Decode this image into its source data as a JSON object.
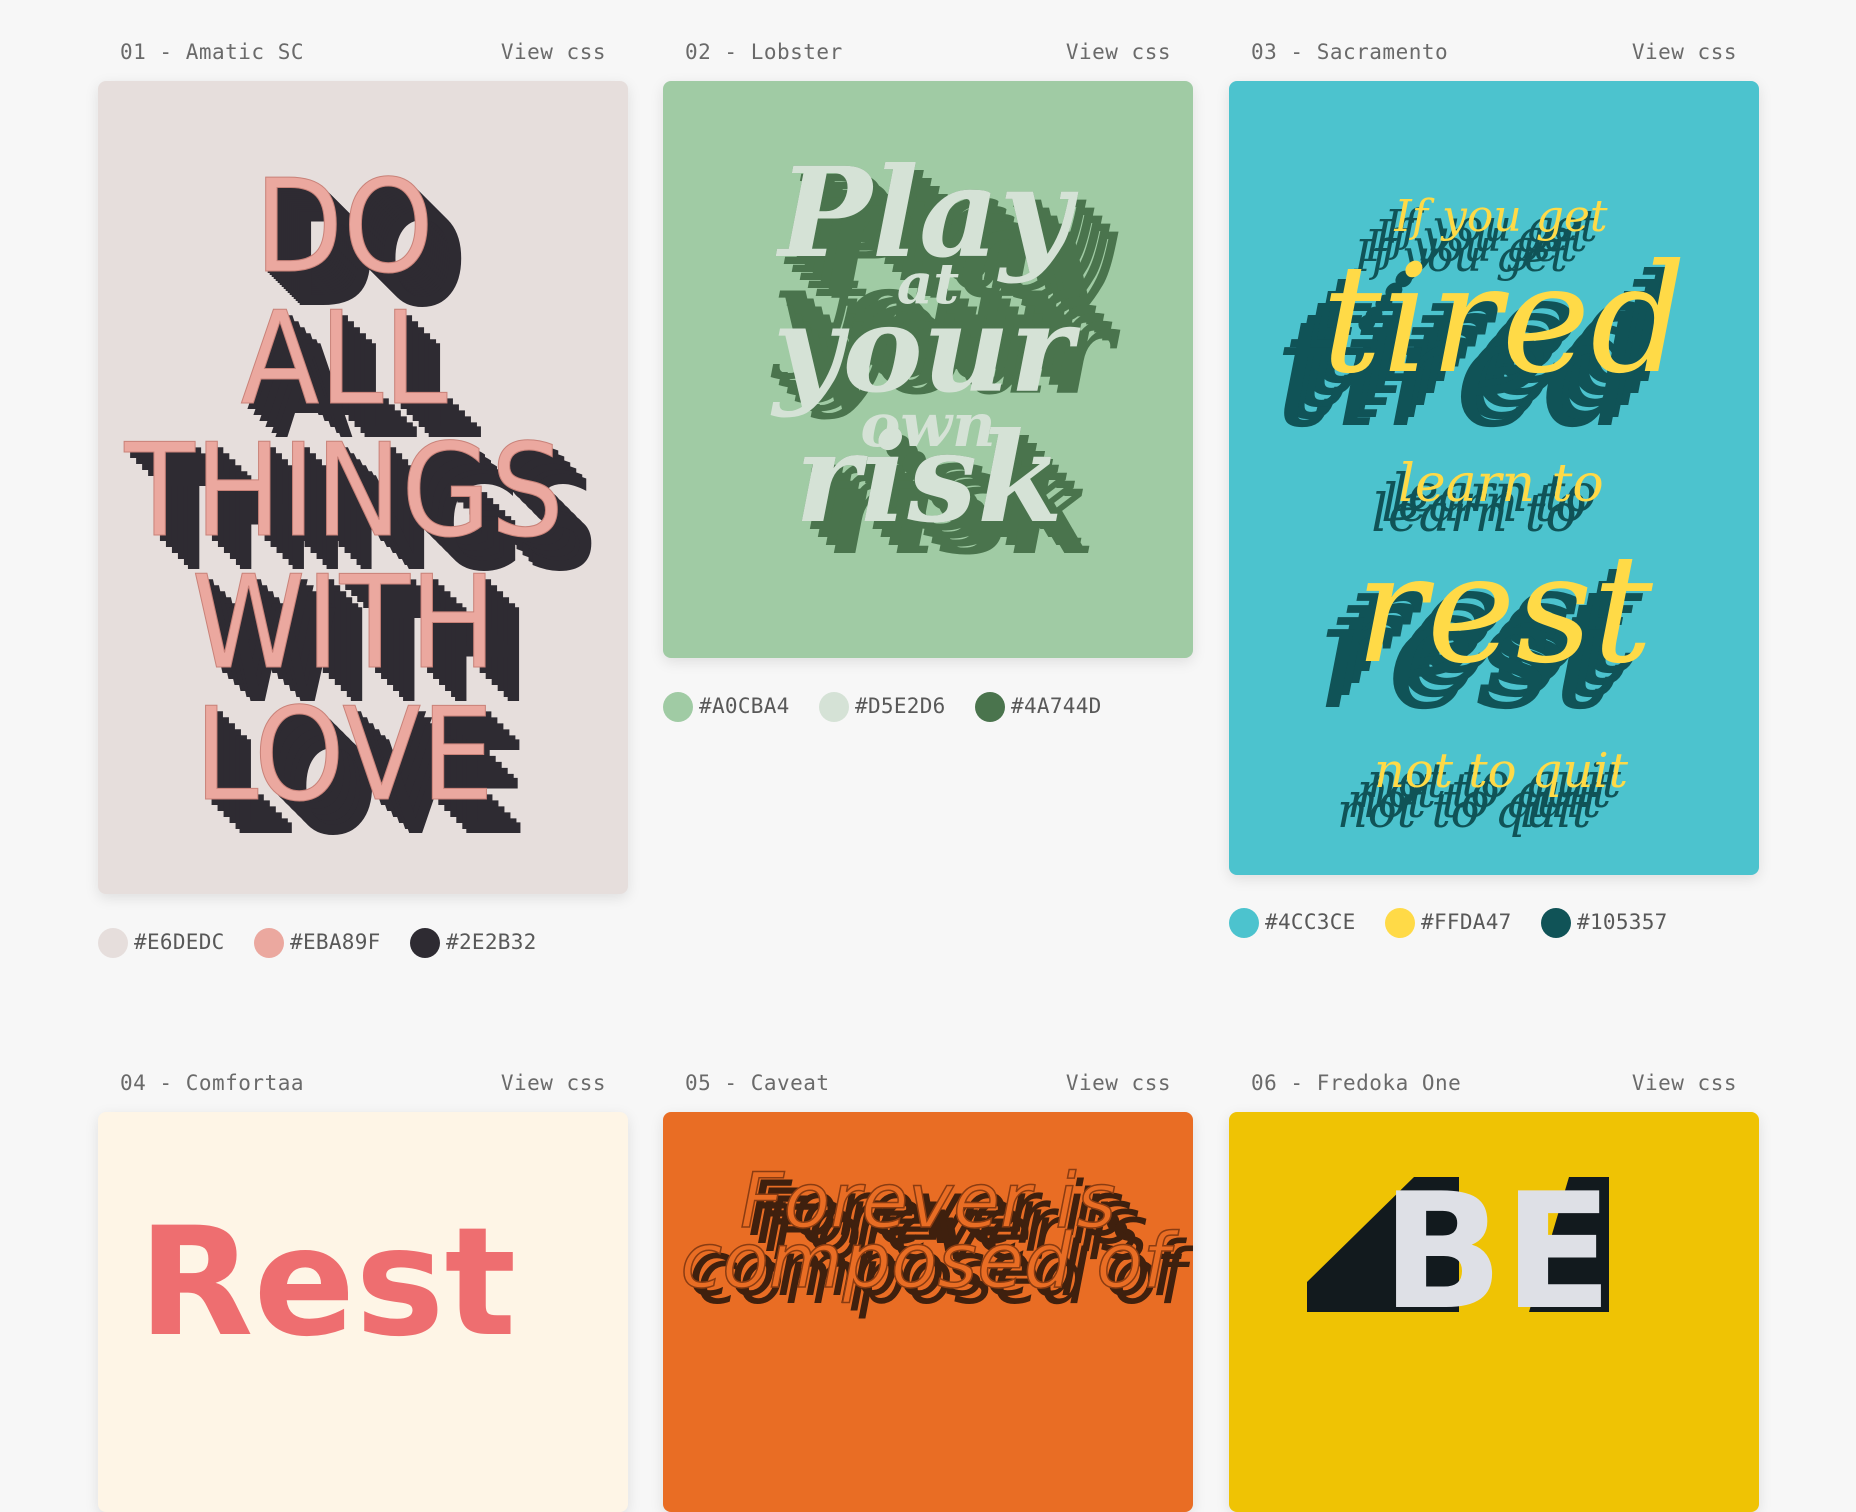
{
  "cards": [
    {
      "title": "01 - Amatic SC",
      "view_css": "View css",
      "poster_lines": [
        "DO",
        "ALL",
        "THINGS",
        "WITH",
        "LOVE"
      ],
      "palette": [
        {
          "hex": "#E6DEDC",
          "color": "#E6DEDC"
        },
        {
          "hex": "#EBA89F",
          "color": "#EBA89F"
        },
        {
          "hex": "#2E2B32",
          "color": "#2E2B32"
        }
      ]
    },
    {
      "title": "02 - Lobster",
      "view_css": "View css",
      "poster_lines": [
        "Play",
        "at",
        "your",
        "own",
        "risk"
      ],
      "palette": [
        {
          "hex": "#A0CBA4",
          "color": "#A0CBA4"
        },
        {
          "hex": "#D5E2D6",
          "color": "#D5E2D6"
        },
        {
          "hex": "#4A744D",
          "color": "#4A744D"
        }
      ]
    },
    {
      "title": "03 - Sacramento",
      "view_css": "View css",
      "poster_lines": [
        "If you get",
        "tired",
        "learn to",
        "rest",
        "not to quit"
      ],
      "palette": [
        {
          "hex": "#4CC3CE",
          "color": "#4CC3CE"
        },
        {
          "hex": "#FFDA47",
          "color": "#FFDA47"
        },
        {
          "hex": "#105357",
          "color": "#105357"
        }
      ]
    },
    {
      "title": "04 - Comfortaa",
      "view_css": "View css",
      "poster_lines": [
        "Rest"
      ],
      "colors": {
        "bg": "#FEF5E6",
        "text": "#EE6E70"
      }
    },
    {
      "title": "05 - Caveat",
      "view_css": "View css",
      "poster_lines": [
        "Forever is",
        "composed of"
      ],
      "colors": {
        "bg": "#E96D24",
        "text": "#E96D24",
        "shadow": "#3F200E"
      }
    },
    {
      "title": "06 - Fredoka One",
      "view_css": "View css",
      "poster_lines": [
        "BE"
      ],
      "colors": {
        "bg": "#EFC304",
        "text": "#DEE0E6",
        "shadow": "#121A1E"
      }
    }
  ]
}
